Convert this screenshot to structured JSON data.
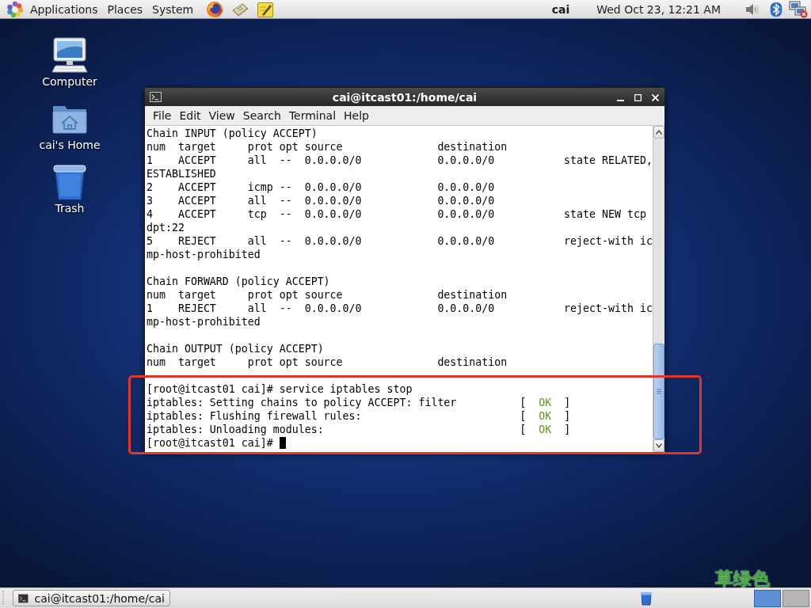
{
  "top_panel": {
    "menus": [
      "Applications",
      "Places",
      "System"
    ],
    "user": "cai",
    "clock": "Wed Oct 23, 12:21 AM"
  },
  "desktop_icons": [
    {
      "kind": "computer",
      "label": "Computer"
    },
    {
      "kind": "home",
      "label": "cai's Home"
    },
    {
      "kind": "trash",
      "label": "Trash"
    }
  ],
  "terminal": {
    "title": "cai@itcast01:/home/cai",
    "menu": [
      "File",
      "Edit",
      "View",
      "Search",
      "Terminal",
      "Help"
    ],
    "lines": [
      {
        "kind": "output",
        "text": "Chain INPUT (policy ACCEPT)"
      },
      {
        "kind": "output",
        "text": "num  target     prot opt source               destination"
      },
      {
        "kind": "output",
        "text": "1    ACCEPT     all  --  0.0.0.0/0            0.0.0.0/0           state RELATED,"
      },
      {
        "kind": "output",
        "text": "ESTABLISHED"
      },
      {
        "kind": "output",
        "text": "2    ACCEPT     icmp --  0.0.0.0/0            0.0.0.0/0"
      },
      {
        "kind": "output",
        "text": "3    ACCEPT     all  --  0.0.0.0/0            0.0.0.0/0"
      },
      {
        "kind": "output",
        "text": "4    ACCEPT     tcp  --  0.0.0.0/0            0.0.0.0/0           state NEW tcp"
      },
      {
        "kind": "output",
        "text": "dpt:22"
      },
      {
        "kind": "output",
        "text": "5    REJECT     all  --  0.0.0.0/0            0.0.0.0/0           reject-with ic"
      },
      {
        "kind": "output",
        "text": "mp-host-prohibited"
      },
      {
        "kind": "blank"
      },
      {
        "kind": "output",
        "text": "Chain FORWARD (policy ACCEPT)"
      },
      {
        "kind": "output",
        "text": "num  target     prot opt source               destination"
      },
      {
        "kind": "output",
        "text": "1    REJECT     all  --  0.0.0.0/0            0.0.0.0/0           reject-with ic"
      },
      {
        "kind": "output",
        "text": "mp-host-prohibited"
      },
      {
        "kind": "blank"
      },
      {
        "kind": "output",
        "text": "Chain OUTPUT (policy ACCEPT)"
      },
      {
        "kind": "output",
        "text": "num  target     prot opt source               destination"
      },
      {
        "kind": "blank"
      },
      {
        "kind": "output",
        "text": "[root@itcast01 cai]# service iptables stop"
      },
      {
        "kind": "status",
        "text": "iptables: Setting chains to policy ACCEPT: filter",
        "open": "[",
        "status": "OK",
        "close": "]"
      },
      {
        "kind": "status",
        "text": "iptables: Flushing firewall rules:",
        "open": "[",
        "status": "OK",
        "close": "]"
      },
      {
        "kind": "status",
        "text": "iptables: Unloading modules:",
        "open": "[",
        "status": "OK",
        "close": "]"
      },
      {
        "kind": "prompt",
        "text": "[root@itcast01 cai]#",
        "cursor": true
      }
    ]
  },
  "annotations": [
    {
      "kind": "box"
    },
    {
      "kind": "label",
      "text": "草绿色"
    }
  ],
  "taskbar": {
    "windows": [
      {
        "title": "cai@itcast01:/home/cai",
        "selected": false
      }
    ],
    "workspaces": [
      {
        "selected": true
      },
      {
        "selected": false
      }
    ]
  }
}
